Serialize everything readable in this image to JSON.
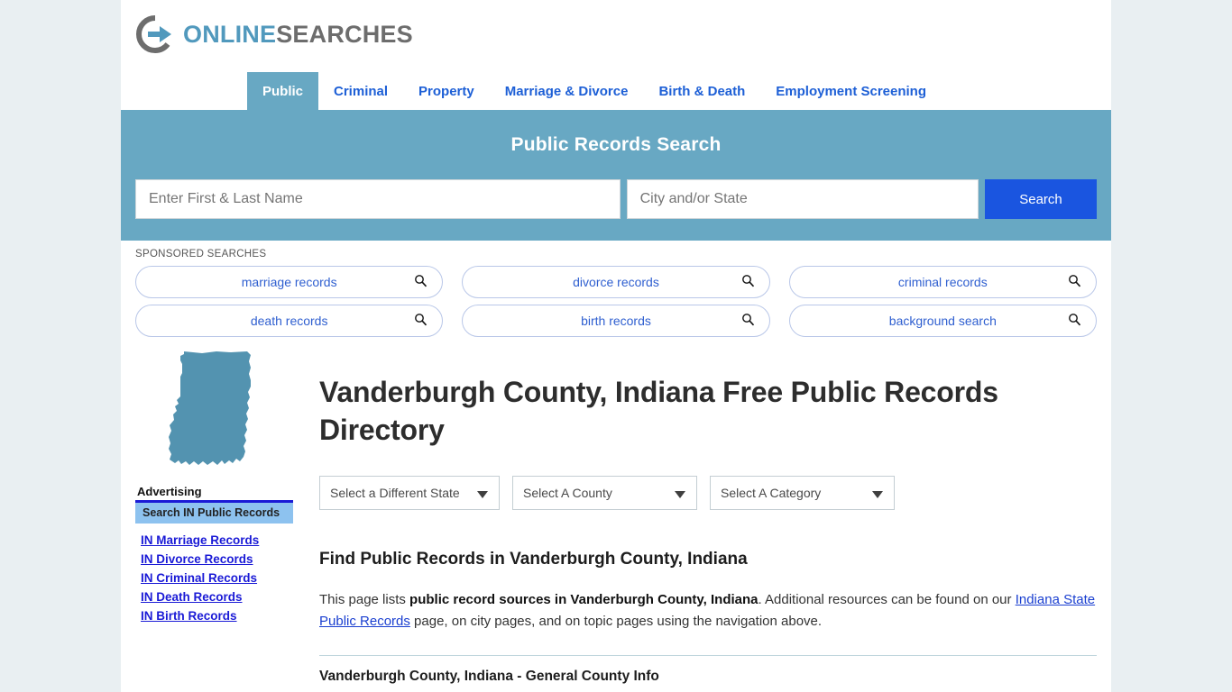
{
  "brand": {
    "name_part1": "ONLINE",
    "name_part2": "SEARCHES",
    "accent_color": "#5199bd",
    "gray_color": "#6d6d6d",
    "logo_icon": "circle-arrow-icon"
  },
  "nav": {
    "items": [
      {
        "label": "Public",
        "active": true
      },
      {
        "label": "Criminal",
        "active": false
      },
      {
        "label": "Property",
        "active": false
      },
      {
        "label": "Marriage & Divorce",
        "active": false
      },
      {
        "label": "Birth & Death",
        "active": false
      },
      {
        "label": "Employment Screening",
        "active": false
      }
    ]
  },
  "search_band": {
    "heading": "Public Records Search",
    "name_placeholder": "Enter First & Last Name",
    "name_value": "",
    "location_placeholder": "City and/or State",
    "location_value": "",
    "button_label": "Search",
    "band_color": "#68a8c3",
    "button_color": "#1a55e0"
  },
  "sponsored": {
    "label": "SPONSORED SEARCHES",
    "items": [
      {
        "label": "marriage records"
      },
      {
        "label": "divorce records"
      },
      {
        "label": "criminal records"
      },
      {
        "label": "death records"
      },
      {
        "label": "birth records"
      },
      {
        "label": "background search"
      }
    ]
  },
  "hero": {
    "state_map": "indiana-state-map",
    "title": "Vanderburgh County, Indiana Free Public Records Directory"
  },
  "selects": {
    "state": "Select a Different State",
    "county": "Select A County",
    "category": "Select A Category"
  },
  "sidebar": {
    "advertising_label": "Advertising",
    "promo_label": "Search IN Public Records",
    "links": [
      {
        "label": "IN Marriage Records"
      },
      {
        "label": "IN Divorce Records"
      },
      {
        "label": "IN Criminal Records"
      },
      {
        "label": "IN Death Records"
      },
      {
        "label": "IN Birth Records"
      }
    ]
  },
  "main": {
    "section_title": "Find Public Records in Vanderburgh County, Indiana",
    "intro_1": "This page lists ",
    "intro_bold": "public record sources in Vanderburgh County, Indiana",
    "intro_2": ". Additional resources can be found on our ",
    "intro_link": "Indiana State Public Records",
    "intro_3": " page, on city pages, and on topic pages using the navigation above.",
    "subsection_title": "Vanderburgh County, Indiana - General County Info"
  }
}
